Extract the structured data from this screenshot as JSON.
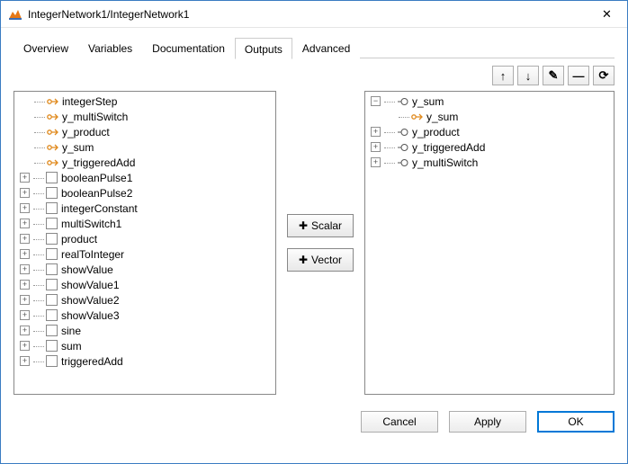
{
  "window": {
    "title": "IntegerNetwork1/IntegerNetwork1",
    "close": "✕"
  },
  "tabs": [
    "Overview",
    "Variables",
    "Documentation",
    "Outputs",
    "Advanced"
  ],
  "active_tab_index": 3,
  "toolbar": {
    "up": "↑",
    "down": "↓",
    "edit": "✎",
    "remove": "—",
    "refresh": "⟳"
  },
  "middle": {
    "scalar": "Scalar",
    "vector": "Vector",
    "plus": "✚"
  },
  "left_tree": {
    "signals": [
      "integerStep",
      "y_multiSwitch",
      "y_product",
      "y_sum",
      "y_triggeredAdd"
    ],
    "blocks": [
      "booleanPulse1",
      "booleanPulse2",
      "integerConstant",
      "multiSwitch1",
      "product",
      "realToInteger",
      "showValue",
      "showValue1",
      "showValue2",
      "showValue3",
      "sine",
      "sum",
      "triggeredAdd"
    ]
  },
  "right_tree": [
    {
      "name": "y_sum",
      "expanded": true,
      "children": [
        "y_sum"
      ]
    },
    {
      "name": "y_product",
      "expanded": false
    },
    {
      "name": "y_triggeredAdd",
      "expanded": false
    },
    {
      "name": "y_multiSwitch",
      "expanded": false
    }
  ],
  "footer": {
    "cancel": "Cancel",
    "apply": "Apply",
    "ok": "OK"
  }
}
